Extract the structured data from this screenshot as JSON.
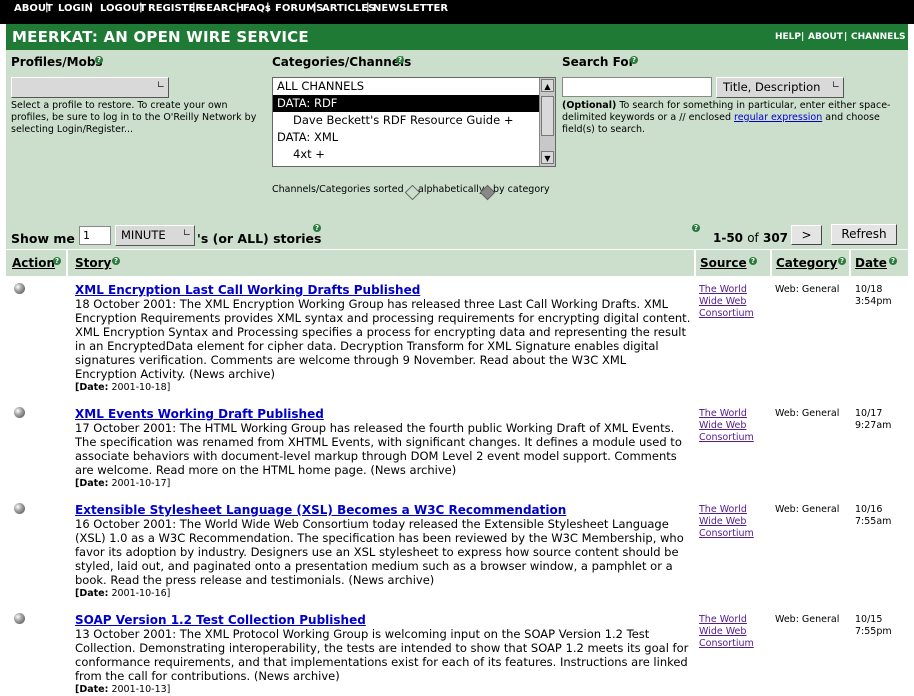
{
  "topnav": [
    "ABOUT",
    "LOGIN",
    "LOGOUT",
    "REGISTER",
    "SEARCH",
    "FAQs",
    "FORUMS",
    "ARTICLES",
    "NEWSLETTER"
  ],
  "banner": {
    "title": "MEERKAT: AN OPEN WIRE SERVICE",
    "links": [
      "HELP",
      "ABOUT",
      "CHANNELS"
    ]
  },
  "profiles": {
    "label": "Profiles/Mobs",
    "select_value": "",
    "help_text": "Select a profile to restore. To create your own profiles, be sure to log in to the O'Reilly Network by selecting Login/Register..."
  },
  "channels": {
    "label": "Categories/Channels",
    "items": [
      "ALL CHANNELS",
      "DATA: RDF",
      "Dave Beckett's RDF Resource Guide +",
      "DATA: XML",
      "4xt +"
    ],
    "selected_index": 1,
    "sort_label": "Channels/Categories sorted",
    "sort_alpha": "alphabetically",
    "sort_cat": "by category"
  },
  "search": {
    "label": "Search For",
    "value": "",
    "field_select": "Title, Description",
    "help_bold": "(Optional)",
    "help_text_1": "To search for something in particular, enter either space-delimited keywords or a // enclosed",
    "help_link": "regular expression",
    "help_text_2": "and choose field(s) to search."
  },
  "controls": {
    "show_me": "Show me",
    "count_value": "1",
    "unit": "MINUTE",
    "suffix": "'s (or ALL) stories",
    "range": "1-50",
    "of": "of",
    "total": "307",
    "next": ">",
    "refresh": "Refresh"
  },
  "columns": {
    "action": "Action",
    "story": "Story",
    "source": "Source",
    "category": "Category",
    "date": "Date"
  },
  "stories": [
    {
      "title": "XML Encryption Last Call Working Drafts Published",
      "text": "18 October 2001: The XML Encryption Working Group has released three Last Call Working Drafts. XML Encryption Requirements provides XML syntax and processing requirements for encrypting digital content. XML Encryption Syntax and Processing specifies a process for encrypting data and representing the result in an EncryptedData element for cipher data. Decryption Transform for XML Signature enables digital signatures verification. Comments are welcome through 9 November. Read about the W3C XML Encryption Activity. (News archive)",
      "date_label": "[Date:",
      "date": "2001-10-18]",
      "source": "The World Wide Web Consortium",
      "category": "Web: General",
      "day": "10/18",
      "time": "3:54pm"
    },
    {
      "title": "XML Events Working Draft Published",
      "text": "17 October 2001: The HTML Working Group has released the fourth public Working Draft of XML Events. The specification was renamed from XHTML Events, with significant changes. It defines a module used to associate behaviors with document-level markup through DOM Level 2 event model support. Comments are welcome. Read more on the HTML home page. (News archive)",
      "date_label": "[Date:",
      "date": "2001-10-17]",
      "source": "The World Wide Web Consortium",
      "category": "Web: General",
      "day": "10/17",
      "time": "9:27am"
    },
    {
      "title": "Extensible Stylesheet Language (XSL) Becomes a W3C Recommendation",
      "text": "16 October 2001: The World Wide Web Consortium today released the Extensible Stylesheet Language (XSL) 1.0 as a W3C Recommendation. The specification has been reviewed by the W3C Membership, who favor its adoption by industry. Designers use an XSL stylesheet to express how source content should be styled, laid out, and paginated onto a presentation medium such as a browser window, a pamphlet or a book. Read the press release and testimonials. (News archive)",
      "date_label": "[Date:",
      "date": "2001-10-16]",
      "source": "The World Wide Web Consortium",
      "category": "Web: General",
      "day": "10/16",
      "time": "7:55am"
    },
    {
      "title": "SOAP Version 1.2 Test Collection Published",
      "text": "13 October 2001: The XML Protocol Working Group is welcoming input on the SOAP Version 1.2 Test Collection. Demonstrating interoperability, the tests are intended to show that SOAP 1.2 meets its goal for conformance requirements, and that implementations exist for each of its features. Instructions are linked from the call for contributions. (News archive)",
      "date_label": "[Date:",
      "date": "2001-10-13]",
      "source": "The World Wide Web Consortium",
      "category": "Web: General",
      "day": "10/15",
      "time": "7:55pm"
    }
  ]
}
